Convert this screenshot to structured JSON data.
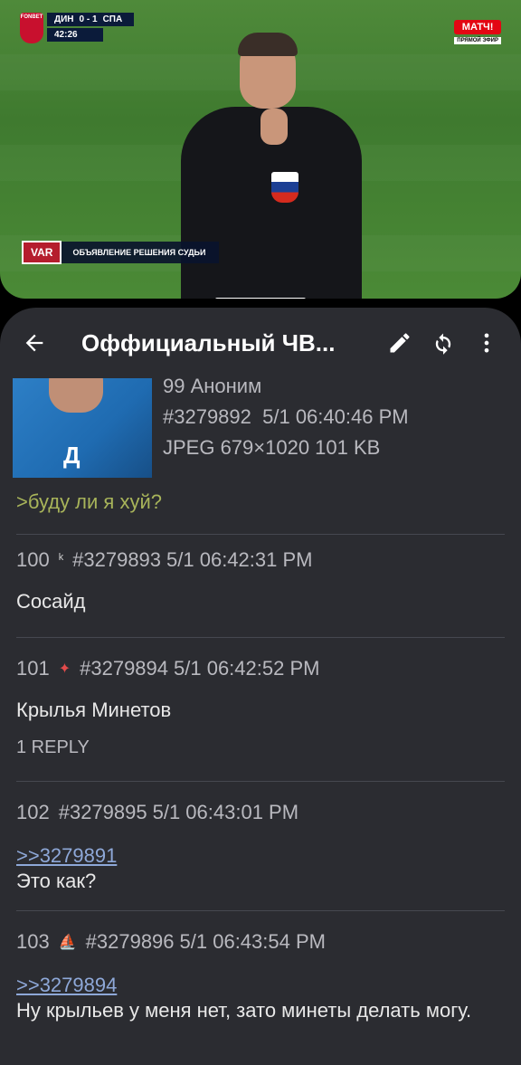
{
  "video": {
    "score_home": "ДИН",
    "score_value": "0 - 1",
    "score_away": "СПА",
    "match_time": "42:26",
    "badge_text": "FONBET",
    "broadcaster": "МАТЧ!",
    "broadcast_tag": "ПРЯМОЙ ЭФИР",
    "var_label": "VAR",
    "var_caption": "ОБЪЯВЛЕНИЕ РЕШЕНИЯ СУДЬИ"
  },
  "appbar": {
    "title": "Оффициальный ЧВ...",
    "icons": [
      "back-arrow-icon",
      "edit-pencil-icon",
      "refresh-icon",
      "more-vert-icon"
    ]
  },
  "posts": [
    {
      "author": "99 Аноним",
      "id": "#3279892",
      "date": "5/1 06:40:46 PM",
      "file": "JPEG 679×1020 101 KB",
      "body": ">буду ли я хуй?"
    },
    {
      "number": "100",
      "flag": "ᵏ",
      "id": "#3279893",
      "date": "5/1 06:42:31 PM",
      "body": "Сосайд"
    },
    {
      "number": "101",
      "flag": "✦",
      "id": "#3279894",
      "date": "5/1 06:42:52 PM",
      "body": "Крылья Минетов",
      "replies": "1 REPLY"
    },
    {
      "number": "102",
      "id": "#3279895",
      "date": "5/1 06:43:01 PM",
      "quote": ">>3279891",
      "body": "Это как?"
    },
    {
      "number": "103",
      "flag": "⛵",
      "id": "#3279896",
      "date": "5/1 06:43:54 PM",
      "quote": ">>3279894",
      "body": "Ну крыльев у меня нет, зато минеты делать могу."
    }
  ],
  "colors": {
    "background": "#2b2c31",
    "greentext": "#a8b45a",
    "link": "#8ea8d8"
  }
}
